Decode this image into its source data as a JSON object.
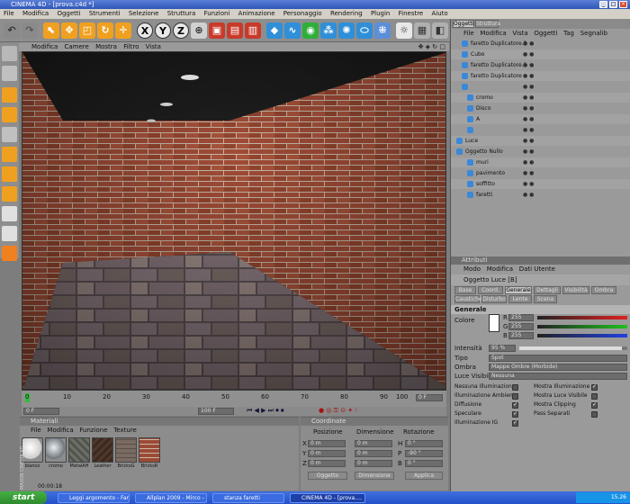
{
  "window": {
    "title": "CINEMA 4D - [prova.c4d *]"
  },
  "menu": [
    "File",
    "Modifica",
    "Oggetti",
    "Strumenti",
    "Selezione",
    "Struttura",
    "Funzioni",
    "Animazione",
    "Personaggio",
    "Rendering",
    "Plugin",
    "Finestre",
    "Aiuto"
  ],
  "viewport_menu": [
    "Modifica",
    "Camere",
    "Mostra",
    "Filtro",
    "Vista"
  ],
  "toolbar_xyz": [
    "X",
    "Y",
    "Z"
  ],
  "object_manager": {
    "tabs": [
      "Oggetti",
      "Struttura"
    ],
    "menu": [
      "File",
      "Modifica",
      "Vista",
      "Oggetti",
      "Tag",
      "Segnalib"
    ],
    "items": [
      {
        "name": "faretto Duplicatore.2",
        "indent": 1
      },
      {
        "name": "Cubo",
        "indent": 1
      },
      {
        "name": "faretto Duplicatore.1",
        "indent": 1
      },
      {
        "name": "faretto Duplicatore",
        "indent": 1
      },
      {
        "name": "",
        "indent": 1
      },
      {
        "name": "cromo",
        "indent": 2
      },
      {
        "name": "Disco",
        "indent": 2
      },
      {
        "name": "A",
        "indent": 2
      },
      {
        "name": "",
        "indent": 2
      },
      {
        "name": "Luce",
        "indent": 0
      },
      {
        "name": "Oggetto Nullo",
        "indent": 0
      },
      {
        "name": "muri",
        "indent": 2
      },
      {
        "name": "pavimento",
        "indent": 2
      },
      {
        "name": "soffitto",
        "indent": 2
      },
      {
        "name": "faretti",
        "indent": 2
      }
    ]
  },
  "attributes": {
    "header": "Attributi",
    "menu": [
      "Modo",
      "Modifica",
      "Dati Utente"
    ],
    "object_title": "Oggetto Luce [B]",
    "tabs_row1": [
      "Base",
      "Coord.",
      "Generale",
      "Dettagli",
      "Visibilità",
      "Ombra"
    ],
    "tabs_row2": [
      "Caustiche",
      "Disturbo",
      "Lente",
      "Scena"
    ],
    "active_tab": "Generale",
    "section": "Generale",
    "color_label": "Colore",
    "rgb": [
      {
        "ch": "R",
        "value": "255"
      },
      {
        "ch": "G",
        "value": "255"
      },
      {
        "ch": "B",
        "value": "255"
      }
    ],
    "intensity_label": "Intensità",
    "intensity_value": "95 %",
    "type_label": "Tipo",
    "type_value": "Spot",
    "shadow_label": "Ombra",
    "shadow_value": "Mappe Ombre (Morbide)",
    "visible_light_label": "Luce Visibile",
    "visible_light_value": "Nessuna",
    "checks_left": [
      {
        "label": "Nessuna Illuminazione",
        "on": false
      },
      {
        "label": "Illuminazione Ambiente",
        "on": false
      },
      {
        "label": "Diffusione",
        "on": true
      },
      {
        "label": "Speculare",
        "on": true
      },
      {
        "label": "Illuminazione IG",
        "on": true
      }
    ],
    "checks_right": [
      {
        "label": "Mostra Illuminazione",
        "on": true
      },
      {
        "label": "Mostra Luce Visibile",
        "on": false
      },
      {
        "label": "Mostra Clipping",
        "on": true
      },
      {
        "label": "Pass Separati",
        "on": false
      }
    ]
  },
  "timeline": {
    "ticks": [
      "0",
      "10",
      "20",
      "30",
      "40",
      "50",
      "60",
      "70",
      "80",
      "90",
      "100"
    ],
    "start_field": "0 F",
    "end_field": "100 F",
    "current_field": "0 F",
    "time_readout": "00:00:18"
  },
  "materials": {
    "header": "Materiali",
    "menu": [
      "File",
      "Modifica",
      "Funzione",
      "Texture"
    ],
    "items": [
      {
        "name": "bianco",
        "color": "#f4f4f4"
      },
      {
        "name": "cromo",
        "color": "#9aa0a6"
      },
      {
        "name": "MetalAH",
        "color": "#6b6f66"
      },
      {
        "name": "Leather",
        "color": "#3a2a20"
      },
      {
        "name": "BricksG",
        "color": "#7a6b63"
      },
      {
        "name": "BricksR",
        "color": "#9b4a35"
      }
    ]
  },
  "coordinates": {
    "header": "Coordinate",
    "col_headers": [
      "Posizione",
      "Dimensione",
      "Rotazione"
    ],
    "rows": [
      {
        "axis": "X",
        "pos": "0 m",
        "dim": "0 m",
        "rot_label": "H",
        "rot": "0 °"
      },
      {
        "axis": "Y",
        "pos": "0 m",
        "dim": "0 m",
        "rot_label": "P",
        "rot": "-90 °"
      },
      {
        "axis": "Z",
        "pos": "0 m",
        "dim": "0 m",
        "rot_label": "B",
        "rot": "0 °"
      }
    ],
    "mode_select": "Oggetto",
    "size_select": "Dimensione",
    "apply_label": "Applica"
  },
  "logo": {
    "line1": "MAXON",
    "line2": "CINEMA 4D"
  },
  "taskbar": {
    "start": "start",
    "tasks": [
      "Leggi argomento - Far...",
      "Allplan 2009 - Mirco - ...",
      "stanza faretti",
      "CINEMA 4D - [prova...."
    ],
    "clock": "15.26"
  },
  "colors": {
    "brick": "#9a4a36",
    "mortar": "#b8a89a",
    "floor": "#7a6f72",
    "accent": "#3a6be0"
  }
}
